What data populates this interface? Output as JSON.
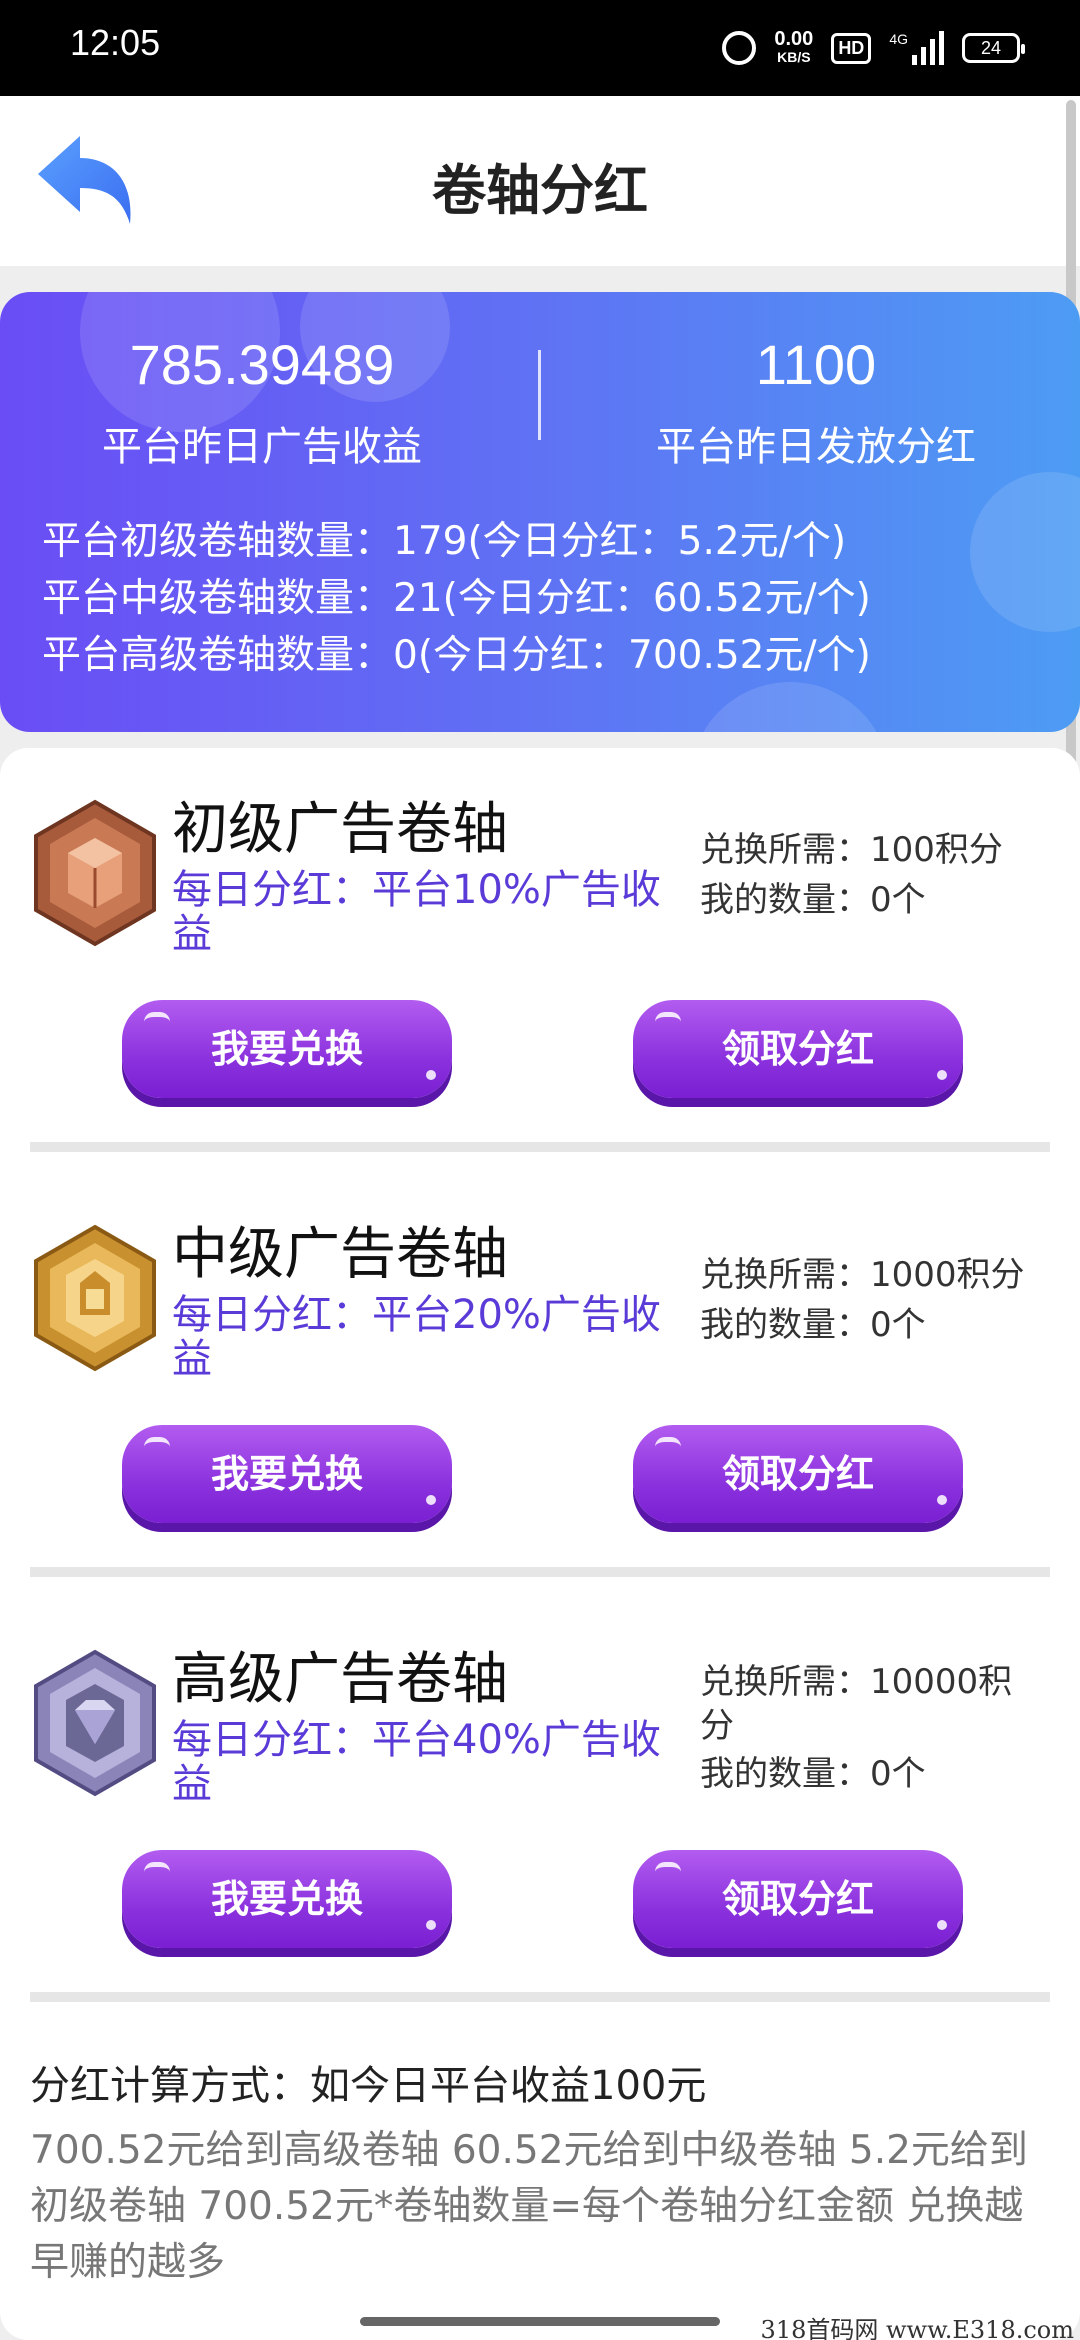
{
  "status_bar": {
    "time": "12:05",
    "net_speed": "0.00",
    "net_speed_unit": "KB/S",
    "hd": "HD",
    "signal": "4G",
    "battery": "24"
  },
  "header": {
    "title": "卷轴分红"
  },
  "stats": {
    "yesterday_ad_income_value": "785.39489",
    "yesterday_ad_income_label": "平台昨日广告收益",
    "yesterday_dividend_value": "1100",
    "yesterday_dividend_label": "平台昨日发放分红",
    "counts": [
      "平台初级卷轴数量：179(今日分红：5.2元/个)",
      "平台中级卷轴数量：21(今日分红：60.52元/个)",
      "平台高级卷轴数量：0(今日分红：700.52元/个)"
    ]
  },
  "tiers": [
    {
      "name": "初级广告卷轴",
      "desc": "每日分红：平台10%广告收益",
      "cost": "兑换所需：100积分",
      "owned": "我的数量：0个",
      "badge": "bronze-badge-icon",
      "exchange_label": "我要兑换",
      "claim_label": "领取分红"
    },
    {
      "name": "中级广告卷轴",
      "desc": "每日分红：平台20%广告收益",
      "cost": "兑换所需：1000积分",
      "owned": "我的数量：0个",
      "badge": "gold-badge-icon",
      "exchange_label": "我要兑换",
      "claim_label": "领取分红"
    },
    {
      "name": "高级广告卷轴",
      "desc": "每日分红：平台40%广告收益",
      "cost": "兑换所需：10000积分",
      "owned": "我的数量：0个",
      "badge": "diamond-badge-icon",
      "exchange_label": "我要兑换",
      "claim_label": "领取分红"
    }
  ],
  "formula": {
    "title": "分红计算方式：如今日平台收益100元",
    "body": "700.52元给到高级卷轴 60.52元给到中级卷轴 5.2元给到初级卷轴 700.52元*卷轴数量=每个卷轴分红金额 兑换越早赚的越多"
  },
  "watermark": "318首码网 www.E318.com",
  "colors": {
    "stats_gradient_start": "#6a4df5",
    "stats_gradient_end": "#4d9cf4",
    "button_purple": "#8b32de",
    "desc_purple": "#5a3bd8"
  }
}
